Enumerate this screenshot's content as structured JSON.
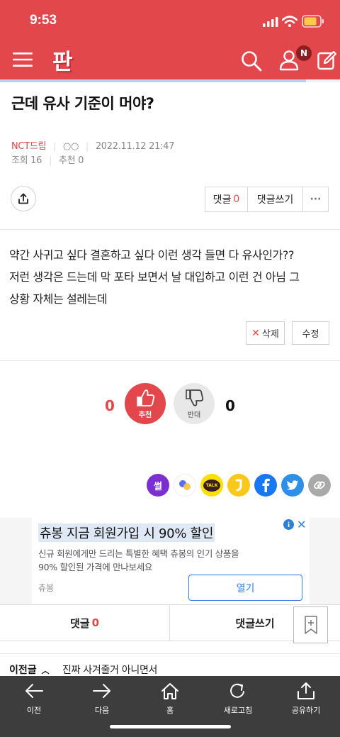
{
  "status_bar": {
    "time": "9:53"
  },
  "header": {
    "logo": "판",
    "notification_badge": "N"
  },
  "post": {
    "title": "근데 유사 기준이 머야?",
    "author": "NCT드림",
    "author_extra": "○○",
    "date": "2022.11.12 21:47",
    "views_label": "조회",
    "views": "16",
    "recommend_label": "추천",
    "recommend": "0",
    "body_lines": [
      "약간 사귀고 싶다 결혼하고 싶다 이런 생각 들면 다 유사인가??",
      "저런 생각은 드는데 막 포타 보면서 날 대입하고 이런 건 아님 그",
      "상황 자체는 설레는데"
    ]
  },
  "actions": {
    "comment_label": "댓글",
    "comment_count": "0",
    "write_comment": "댓글쓰기",
    "more": "···",
    "delete": "삭제",
    "edit": "수정"
  },
  "vote": {
    "up_count": "0",
    "up_label": "추천",
    "down_label": "반대",
    "down_count": "0"
  },
  "share": {
    "ssul_label": "썰",
    "talk_label": "TALK"
  },
  "ad": {
    "headline": "츄봉 지금 회원가입 시 90% 할인",
    "desc_line1": "신규 회원에게만 드리는 특별한 혜택 츄봉의 인기 상품을",
    "desc_line2": "90% 할인된 가격에 만나보세요",
    "brand": "츄봉",
    "open_button": "열기"
  },
  "bottom_tabs": {
    "comment_label": "댓글",
    "comment_count": "0",
    "write_comment": "댓글쓰기"
  },
  "prev_post": {
    "label": "이전글",
    "title": "진짜 사겨줄거 아니면서"
  },
  "toolbar": {
    "back": "이전",
    "forward": "다음",
    "home": "홈",
    "refresh": "새로고침",
    "share": "공유하기"
  },
  "colors": {
    "brand_red": "#e2474b",
    "link_blue": "#2f7fd8",
    "toolbar_bg": "#3d3d3d"
  }
}
